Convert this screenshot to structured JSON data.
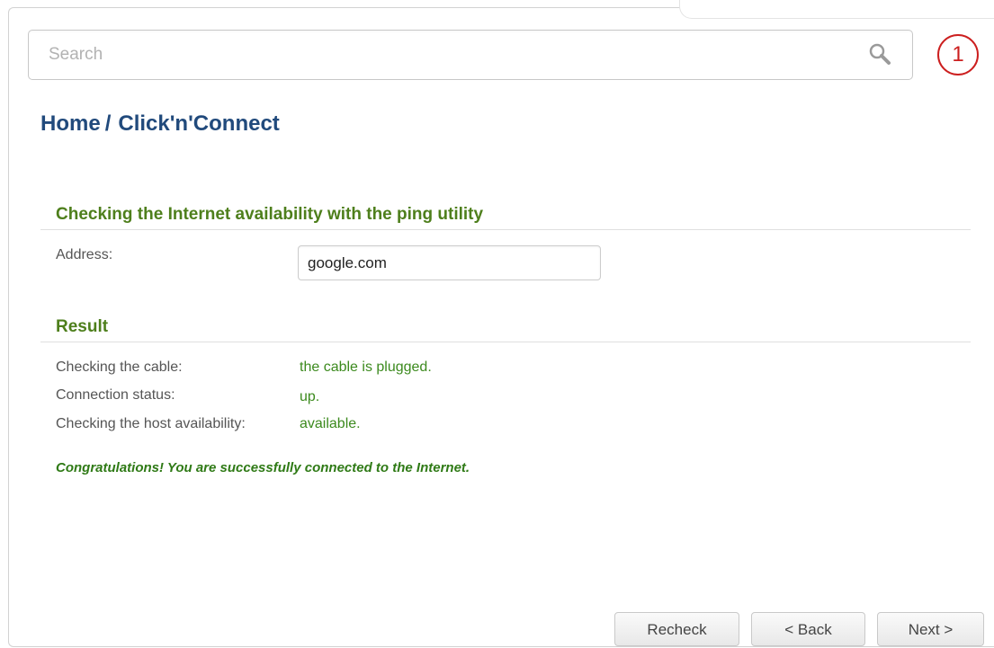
{
  "search": {
    "placeholder": "Search",
    "icon": "search-icon"
  },
  "notifications": {
    "count": "1",
    "icon": "notification-badge-icon",
    "color": "#cc1f1f"
  },
  "breadcrumb": {
    "home": "Home",
    "separator": "/",
    "current": "Click'n'Connect"
  },
  "ping_section": {
    "title": "Checking the Internet availability with the ping utility",
    "address_label": "Address:",
    "address_value": "google.com"
  },
  "result_section": {
    "title": "Result",
    "rows": [
      {
        "label": "Checking the cable:",
        "value": "the cable is plugged."
      },
      {
        "label": "Connection status:",
        "value": "up."
      },
      {
        "label": "Checking the host availability:",
        "value": "available."
      }
    ]
  },
  "message": "Congratulations! You are successfully connected to the Internet.",
  "buttons": {
    "recheck": "Recheck",
    "back": "< Back",
    "next": "Next >"
  },
  "colors": {
    "heading_blue": "#214a7c",
    "section_green": "#4e7f1c",
    "value_green": "#3c8a1e",
    "badge_red": "#cc1f1f"
  }
}
